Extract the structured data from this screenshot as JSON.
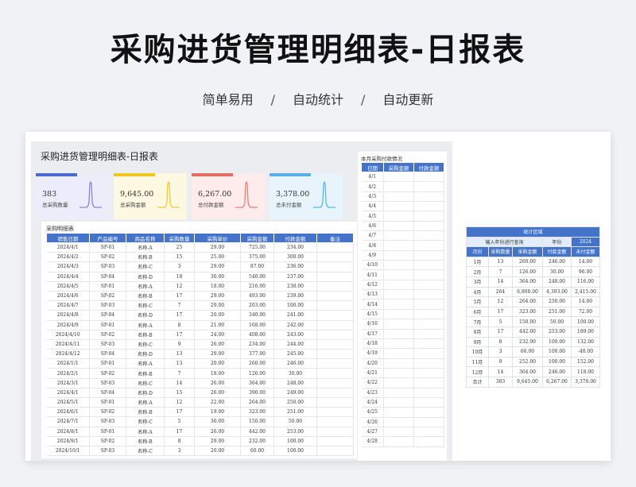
{
  "hero": {
    "title": "采购进货管理明细表-日报表",
    "tags": [
      "简单易用",
      "自动统计",
      "自动更新"
    ],
    "sep": "/"
  },
  "sheet_title": "采购进货管理明细表-日报表",
  "cards": [
    {
      "value": "383",
      "label": "总采购数量",
      "bg": "#ececfa",
      "bar": "#4d6bcc",
      "line": "#8a84d8"
    },
    {
      "value": "9,645.00",
      "label": "总采购金额",
      "bg": "#fdf8e1",
      "bar": "#f3c521",
      "line": "#f0c93a"
    },
    {
      "value": "6,267.00",
      "label": "总付款金额",
      "bg": "#fdeceb",
      "bar": "#e26e62",
      "line": "#ef7d77"
    },
    {
      "value": "3,378.00",
      "label": "总未付金额",
      "bg": "#e8f4fc",
      "bar": "#5aaee6",
      "line": "#5ab5ea"
    }
  ],
  "detail": {
    "caption": "采购明细表",
    "headers": [
      "销售日期",
      "产品编号",
      "商品名称",
      "采购数量",
      "采购单价",
      "采购金额",
      "付款金额",
      "备注"
    ],
    "rows": [
      [
        "2024/4/1",
        "SP-01",
        "名称-A",
        "25",
        "29.00",
        "725.00",
        "234.00",
        ""
      ],
      [
        "2024/4/2",
        "SP-02",
        "名称-B",
        "15",
        "25.00",
        "375.00",
        "300.00",
        ""
      ],
      [
        "2024/4/3",
        "SP-03",
        "名称-C",
        "3",
        "29.00",
        "87.00",
        "236.00",
        ""
      ],
      [
        "2024/4/4",
        "SP-04",
        "名称-D",
        "18",
        "30.00",
        "540.00",
        "237.00",
        ""
      ],
      [
        "2024/4/5",
        "SP-01",
        "名称-A",
        "12",
        "18.00",
        "216.00",
        "238.00",
        ""
      ],
      [
        "2024/4/6",
        "SP-02",
        "名称-B",
        "17",
        "29.00",
        "493.00",
        "239.00",
        ""
      ],
      [
        "2024/4/7",
        "SP-03",
        "名称-C",
        "7",
        "29.00",
        "203.00",
        "100.00",
        ""
      ],
      [
        "2024/4/8",
        "SP-04",
        "名称-D",
        "17",
        "20.00",
        "340.00",
        "241.00",
        ""
      ],
      [
        "2024/4/9",
        "SP-01",
        "名称-A",
        "8",
        "21.00",
        "168.00",
        "242.00",
        ""
      ],
      [
        "2024/4/10",
        "SP-02",
        "名称-B",
        "17",
        "24.00",
        "408.00",
        "243.00",
        ""
      ],
      [
        "2024/4/11",
        "SP-03",
        "名称-C",
        "9",
        "26.00",
        "234.00",
        "244.00",
        ""
      ],
      [
        "2024/4/12",
        "SP-04",
        "名称-D",
        "13",
        "29.00",
        "377.00",
        "245.00",
        ""
      ],
      [
        "2024/1/1",
        "SP-01",
        "名称-A",
        "13",
        "20.00",
        "260.00",
        "246.00",
        ""
      ],
      [
        "2024/2/1",
        "SP-02",
        "名称-B",
        "7",
        "18.00",
        "126.00",
        "30.00",
        ""
      ],
      [
        "2024/3/1",
        "SP-03",
        "名称-C",
        "14",
        "26.00",
        "364.00",
        "248.00",
        ""
      ],
      [
        "2024/4/1",
        "SP-04",
        "名称-D",
        "15",
        "26.00",
        "390.00",
        "249.00",
        ""
      ],
      [
        "2024/5/1",
        "SP-01",
        "名称-A",
        "12",
        "22.00",
        "264.00",
        "250.00",
        ""
      ],
      [
        "2024/6/1",
        "SP-02",
        "名称-B",
        "17",
        "19.00",
        "323.00",
        "251.00",
        ""
      ],
      [
        "2024/7/1",
        "SP-03",
        "名称-C",
        "5",
        "30.00",
        "150.00",
        "50.00",
        ""
      ],
      [
        "2024/8/1",
        "SP-01",
        "名称-A",
        "17",
        "26.00",
        "442.00",
        "253.00",
        ""
      ],
      [
        "2024/9/1",
        "SP-02",
        "名称-B",
        "8",
        "29.00",
        "232.00",
        "100.00",
        ""
      ],
      [
        "2024/10/1",
        "SP-03",
        "名称-C",
        "3",
        "20.00",
        "60.00",
        "100.00",
        ""
      ]
    ]
  },
  "payments": {
    "caption": "本月采购付款情况",
    "headers": [
      "日期",
      "采购金额",
      "付款金额"
    ],
    "dates": [
      "4/1",
      "4/2",
      "4/3",
      "4/4",
      "4/5",
      "4/6",
      "4/7",
      "4/8",
      "4/9",
      "4/10",
      "4/11",
      "4/12",
      "4/13",
      "4/14",
      "4/15",
      "4/16",
      "4/17",
      "4/18",
      "4/19",
      "4/20",
      "4/21",
      "4/22",
      "4/23",
      "4/24",
      "4/25",
      "4/26",
      "4/27",
      "4/28"
    ]
  },
  "stats": {
    "title": "统计区域",
    "query_label": "输入年份进行查询",
    "year_label": "年份",
    "year": "2024",
    "headers": [
      "月份",
      "采购数量",
      "采购金额",
      "付款金额",
      "未付金额"
    ],
    "rows": [
      [
        "1月",
        "13",
        "260.00",
        "246.00",
        "14.00"
      ],
      [
        "2月",
        "7",
        "126.00",
        "30.00",
        "96.00"
      ],
      [
        "3月",
        "14",
        "364.00",
        "248.00",
        "116.00"
      ],
      [
        "4月",
        "264",
        "6,808.00",
        "4,393.00",
        "2,415.00"
      ],
      [
        "5月",
        "12",
        "264.00",
        "250.00",
        "14.00"
      ],
      [
        "6月",
        "17",
        "323.00",
        "251.00",
        "72.00"
      ],
      [
        "7月",
        "5",
        "150.00",
        "50.00",
        "100.00"
      ],
      [
        "8月",
        "17",
        "442.00",
        "253.00",
        "189.00"
      ],
      [
        "9月",
        "8",
        "232.00",
        "100.00",
        "132.00"
      ],
      [
        "10月",
        "3",
        "60.00",
        "100.00",
        "-40.00"
      ],
      [
        "11月",
        "9",
        "252.00",
        "100.00",
        "152.00"
      ],
      [
        "12月",
        "14",
        "364.00",
        "246.00",
        "118.00"
      ],
      [
        "合计",
        "383",
        "9,645.00",
        "6,267.00",
        "3,378.00"
      ]
    ]
  }
}
